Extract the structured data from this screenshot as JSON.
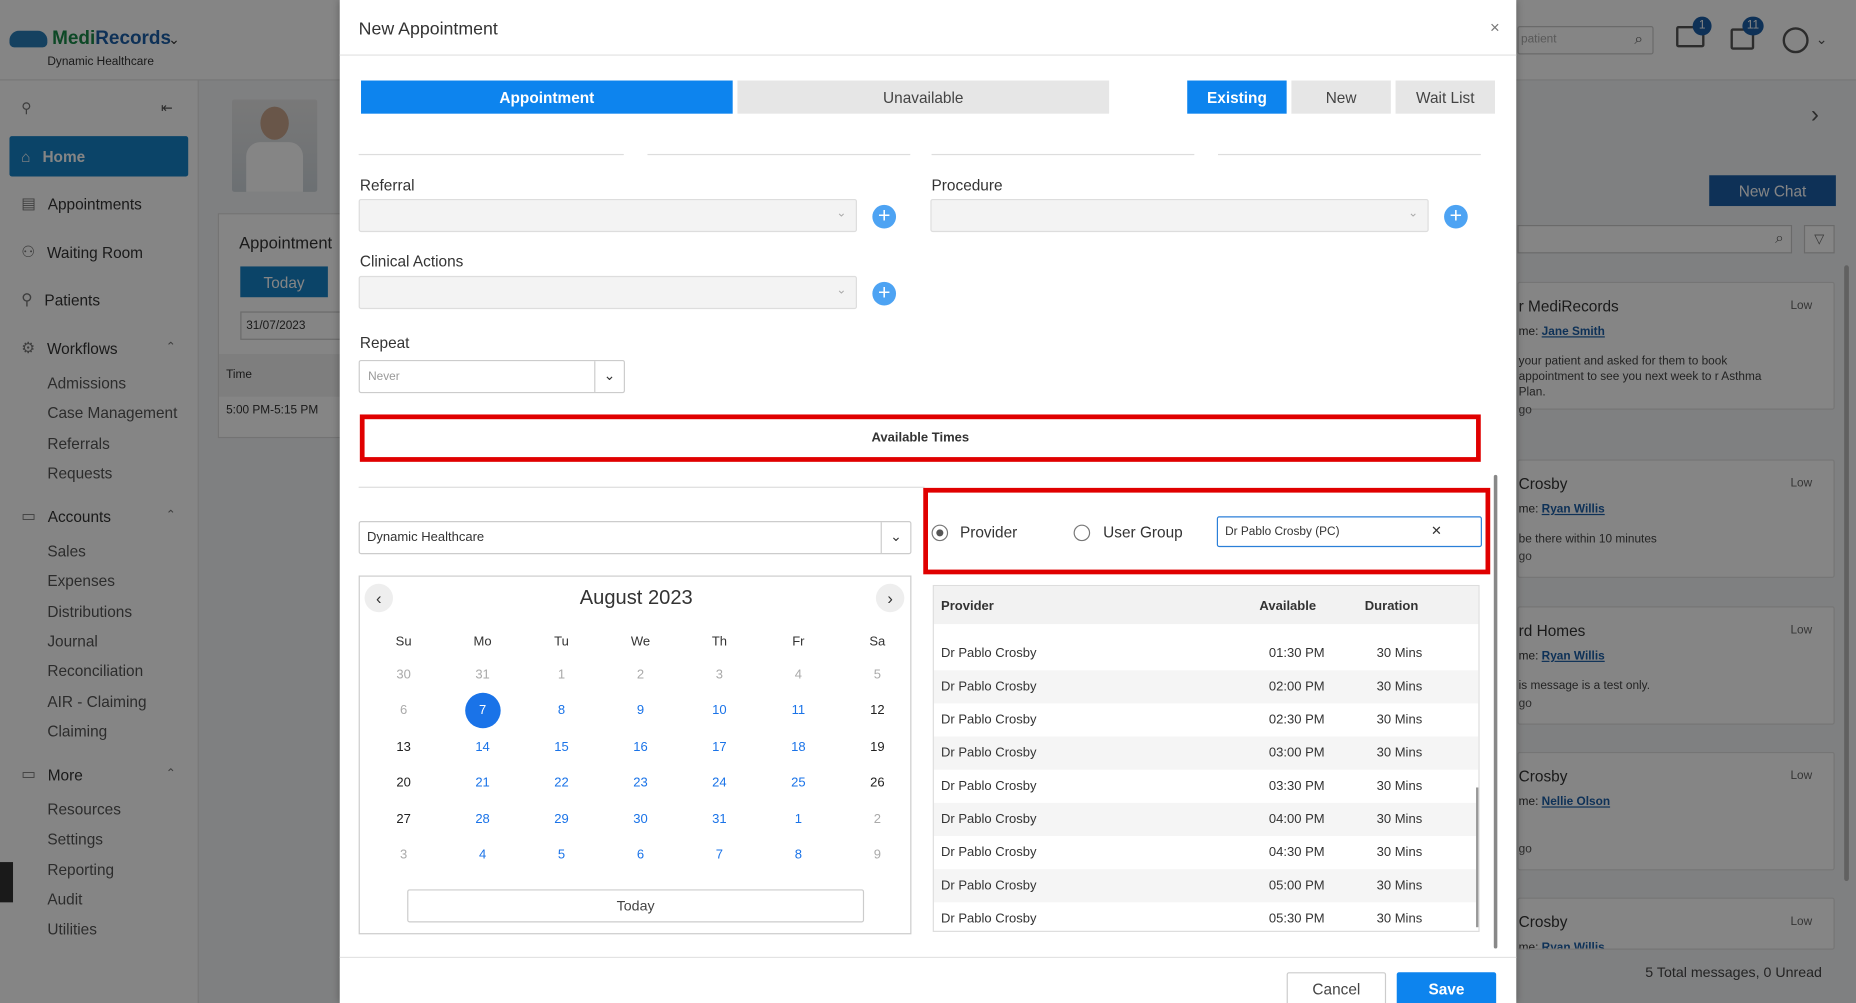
{
  "app": {
    "brand_a": "Medi",
    "brand_b": "Records",
    "org": "Dynamic Healthcare",
    "search_placeholder": "patient",
    "mail_badge": "1",
    "tasks_badge": "11"
  },
  "sidebar": {
    "items": [
      {
        "label": "Home"
      },
      {
        "label": "Appointments"
      },
      {
        "label": "Waiting Room"
      },
      {
        "label": "Patients"
      },
      {
        "label": "Workflows"
      }
    ],
    "workflows": [
      "Admissions",
      "Case Management",
      "Referrals",
      "Requests"
    ],
    "accounts_label": "Accounts",
    "accounts": [
      "Sales",
      "Expenses",
      "Distributions",
      "Journal",
      "Reconciliation",
      "AIR - Claiming",
      "Claiming"
    ],
    "more_label": "More",
    "more": [
      "Resources",
      "Settings",
      "Reporting",
      "Audit",
      "Utilities"
    ]
  },
  "middle": {
    "title": "Appointment",
    "today": "Today",
    "date": "31/07/2023",
    "time_header": "Time",
    "slot": "5:00 PM-5:15 PM"
  },
  "right": {
    "new_chat": "New Chat",
    "messages": [
      {
        "title": "r MediRecords",
        "priority": "Low",
        "name_prefix": "me:",
        "name": "Jane Smith",
        "body": "your patient and asked for them to book appointment to see you next week to r Asthma Plan.",
        "ago": "go"
      },
      {
        "title": "Crosby",
        "priority": "Low",
        "name_prefix": "me:",
        "name": "Ryan Willis",
        "body": "be there within 10 minutes",
        "ago": "go"
      },
      {
        "title": "rd Homes",
        "priority": "Low",
        "name_prefix": "me:",
        "name": "Ryan Willis",
        "body": "is message is a test only.",
        "ago": "go"
      },
      {
        "title": "Crosby",
        "priority": "Low",
        "name_prefix": "me:",
        "name": "Nellie Olson",
        "body": "",
        "ago": "go"
      },
      {
        "title": "Crosby",
        "priority": "Low",
        "name_prefix": "me:",
        "name": "Ryan Willis",
        "body": "",
        "ago": ""
      }
    ],
    "footer": "5 Total messages, 0 Unread"
  },
  "modal": {
    "title": "New Appointment",
    "close": "×",
    "tabs": {
      "appointment": "Appointment",
      "unavailable": "Unavailable",
      "existing": "Existing",
      "new": "New",
      "waitlist": "Wait List"
    },
    "referral_label": "Referral",
    "procedure_label": "Procedure",
    "clinical_label": "Clinical Actions",
    "repeat_label": "Repeat",
    "repeat_value": "Never",
    "available_times": "Available Times",
    "location": "Dynamic Healthcare",
    "provider_radio": "Provider",
    "usergroup_radio": "User Group",
    "provider_value": "Dr Pablo Crosby (PC)",
    "calendar": {
      "month": "August 2023",
      "weekdays": [
        "Su",
        "Mo",
        "Tu",
        "We",
        "Th",
        "Fr",
        "Sa"
      ],
      "weeks": [
        [
          "30",
          "31",
          "1",
          "2",
          "3",
          "4",
          "5"
        ],
        [
          "6",
          "7",
          "8",
          "9",
          "10",
          "11",
          "12"
        ],
        [
          "13",
          "14",
          "15",
          "16",
          "17",
          "18",
          "19"
        ],
        [
          "20",
          "21",
          "22",
          "23",
          "24",
          "25",
          "26"
        ],
        [
          "27",
          "28",
          "29",
          "30",
          "31",
          "1",
          "2"
        ],
        [
          "3",
          "4",
          "5",
          "6",
          "7",
          "8",
          "9"
        ]
      ],
      "today_btn": "Today",
      "selected": "7"
    },
    "table": {
      "headers": {
        "provider": "Provider",
        "available": "Available",
        "duration": "Duration"
      },
      "rows": [
        {
          "provider": "Dr Pablo Crosby",
          "time": "01:30 PM",
          "duration": "30 Mins"
        },
        {
          "provider": "Dr Pablo Crosby",
          "time": "02:00 PM",
          "duration": "30 Mins"
        },
        {
          "provider": "Dr Pablo Crosby",
          "time": "02:30 PM",
          "duration": "30 Mins"
        },
        {
          "provider": "Dr Pablo Crosby",
          "time": "03:00 PM",
          "duration": "30 Mins"
        },
        {
          "provider": "Dr Pablo Crosby",
          "time": "03:30 PM",
          "duration": "30 Mins"
        },
        {
          "provider": "Dr Pablo Crosby",
          "time": "04:00 PM",
          "duration": "30 Mins"
        },
        {
          "provider": "Dr Pablo Crosby",
          "time": "04:30 PM",
          "duration": "30 Mins"
        },
        {
          "provider": "Dr Pablo Crosby",
          "time": "05:00 PM",
          "duration": "30 Mins"
        },
        {
          "provider": "Dr Pablo Crosby",
          "time": "05:30 PM",
          "duration": "30 Mins"
        }
      ]
    },
    "cancel": "Cancel",
    "save": "Save"
  },
  "colors": {
    "primary": "#0d84ee",
    "sidebar_active": "#1683c7",
    "highlight": "#e00000",
    "brand_green": "#1a8a4a"
  }
}
